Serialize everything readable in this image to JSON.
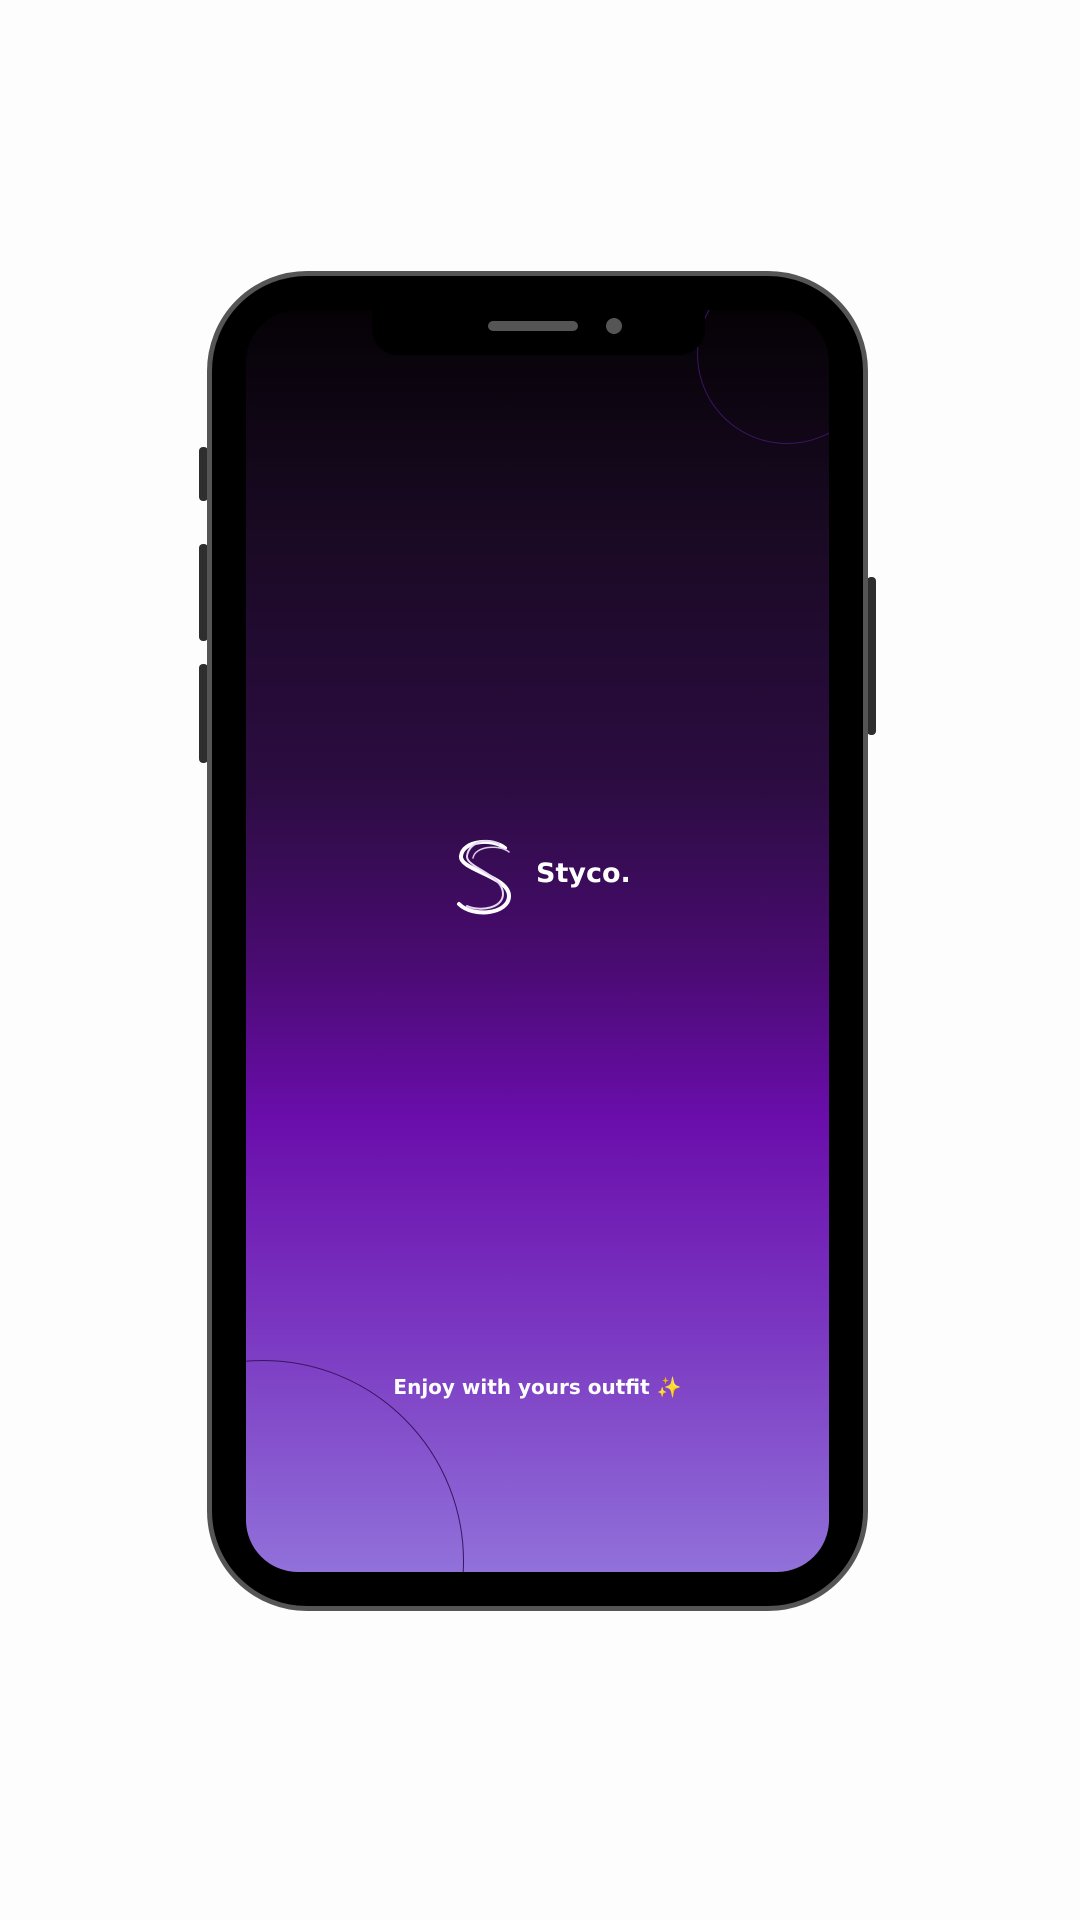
{
  "app": {
    "brand": "Styco.",
    "tagline": "Enjoy with yours outfit",
    "tagline_emoji": "✨"
  },
  "colors": {
    "gradient_top": "#050205",
    "gradient_mid": "#6a0dab",
    "gradient_bottom": "#9171da",
    "sparkle": "#f5b731"
  }
}
